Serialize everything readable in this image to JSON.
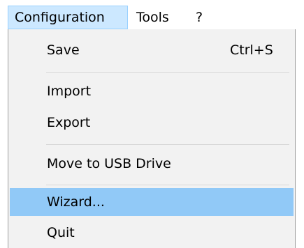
{
  "menubar": {
    "items": [
      {
        "label": "Configuration"
      },
      {
        "label": "Tools"
      },
      {
        "label": "?"
      }
    ]
  },
  "dropdown": {
    "items": [
      {
        "label": "Save",
        "shortcut": "Ctrl+S"
      },
      {
        "label": "Import"
      },
      {
        "label": "Export"
      },
      {
        "label": "Move to USB Drive"
      },
      {
        "label": "Wizard..."
      },
      {
        "label": "Quit"
      }
    ],
    "highlighted_item": "Wizard..."
  },
  "colors": {
    "menubar_active_bg": "#cce8ff",
    "menubar_active_border": "#99d1ff",
    "dropdown_bg": "#f2f2f2",
    "item_highlight_bg": "#91c9f7",
    "separator": "#d7d7d7"
  }
}
